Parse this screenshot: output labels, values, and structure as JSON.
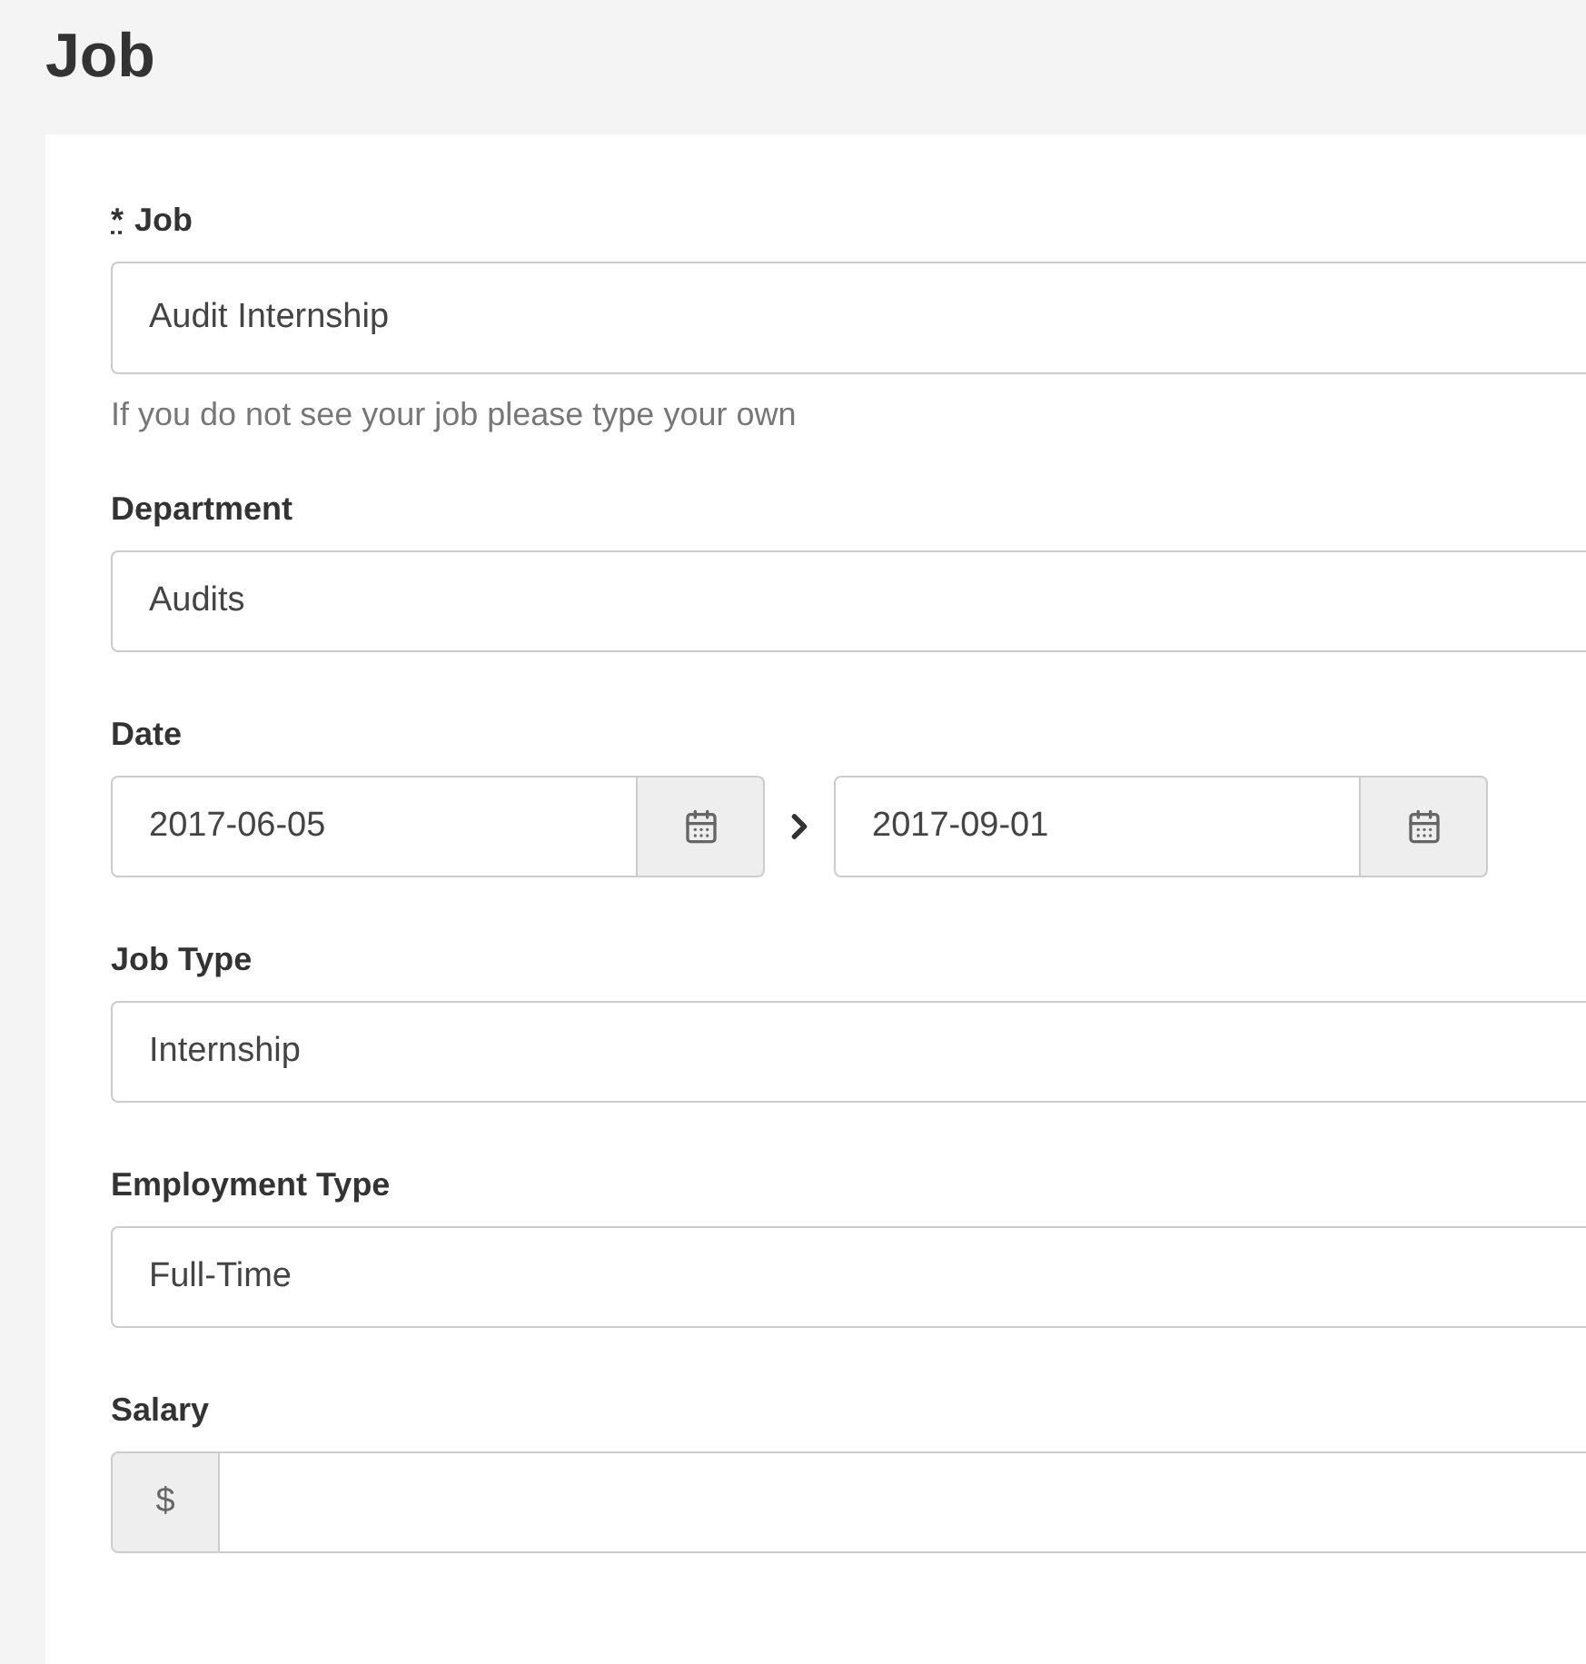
{
  "title": "Job",
  "fields": [
    {
      "kind": "text",
      "label": "Job",
      "required_mark": "*",
      "value": "Audit Internship",
      "help": "If you do not see your job please type your own"
    },
    {
      "kind": "text",
      "label": "Department",
      "value": "Audits"
    },
    {
      "kind": "daterange",
      "label": "Date",
      "start": "2017-06-05",
      "end": "2017-09-01"
    },
    {
      "kind": "text",
      "label": "Job Type",
      "value": "Internship"
    },
    {
      "kind": "text",
      "label": "Employment Type",
      "value": "Full-Time"
    },
    {
      "kind": "money",
      "label": "Salary",
      "prefix": "$"
    }
  ]
}
